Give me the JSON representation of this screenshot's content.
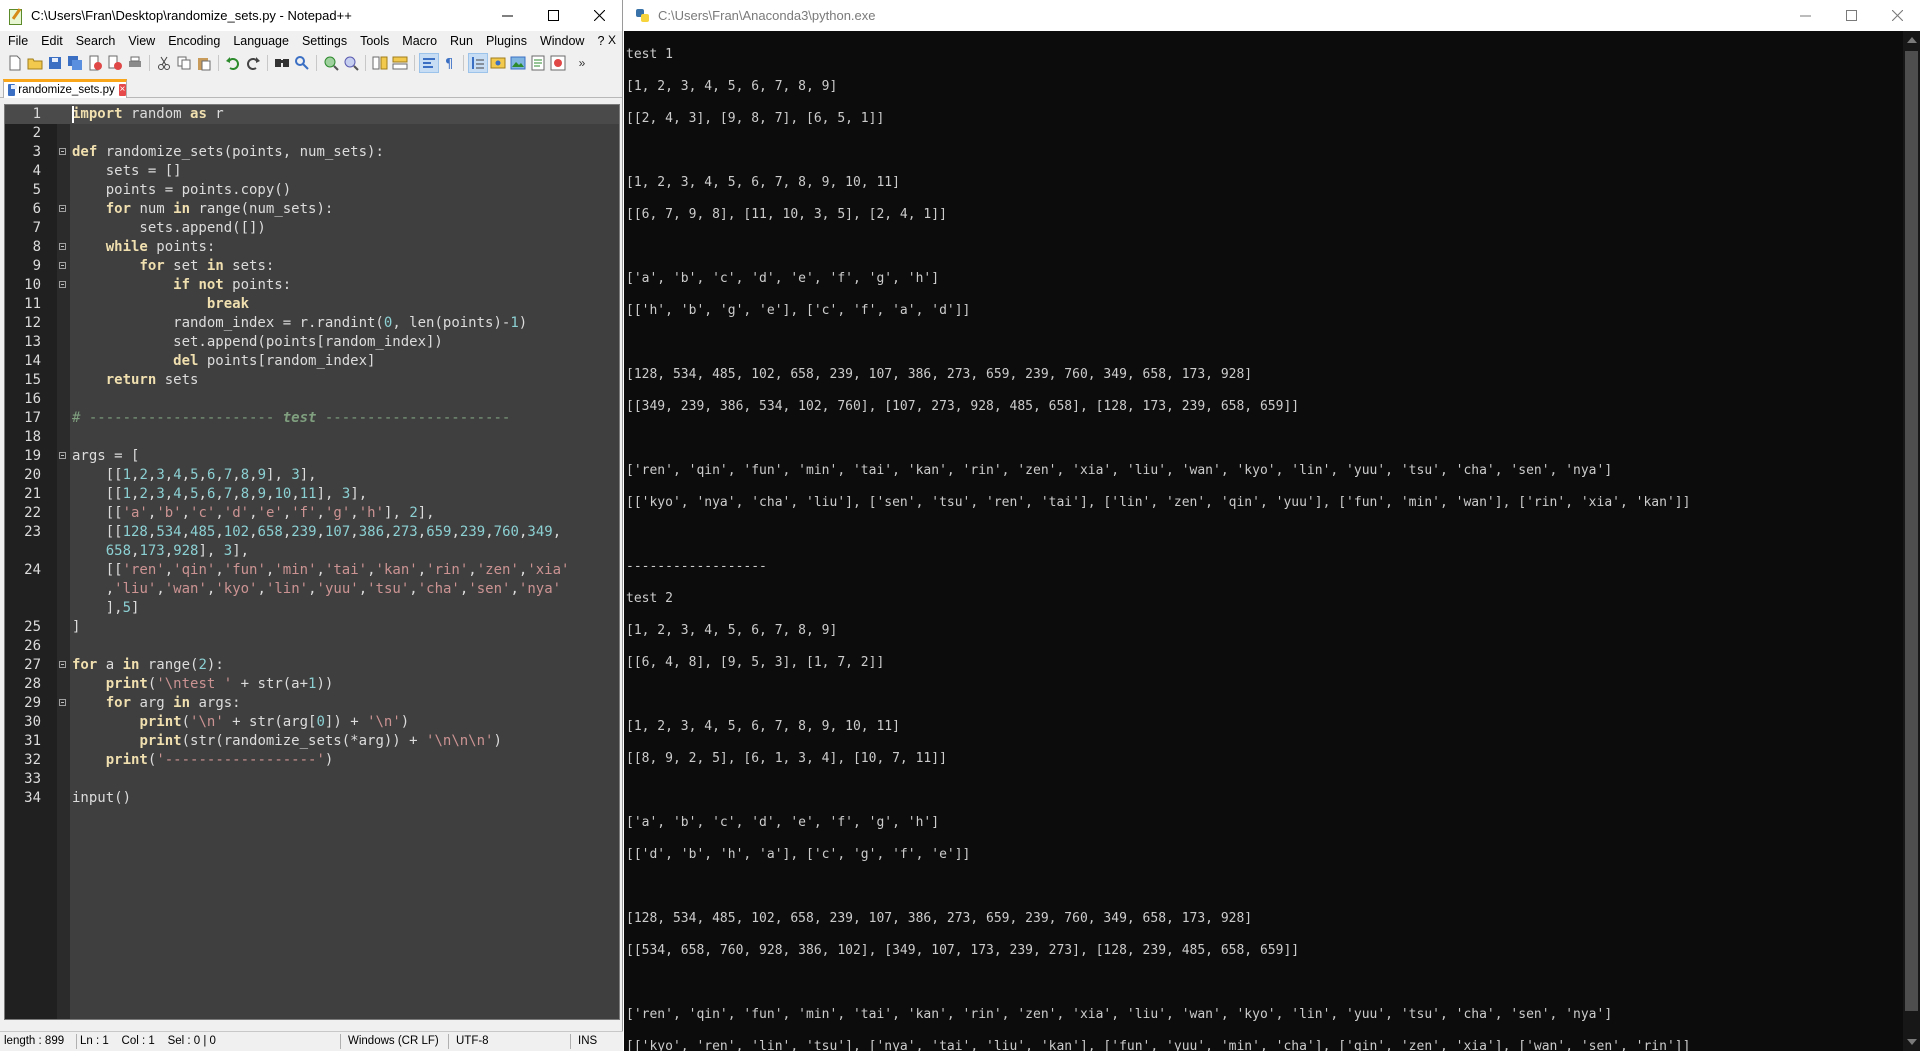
{
  "notepad": {
    "title": "C:\\Users\\Fran\\Desktop\\randomize_sets.py - Notepad++",
    "menu": [
      "File",
      "Edit",
      "Search",
      "View",
      "Encoding",
      "Language",
      "Settings",
      "Tools",
      "Macro",
      "Run",
      "Plugins",
      "Window",
      "?"
    ],
    "menu_close": "X",
    "tab_name": "randomize_sets.py",
    "tab_close": "×",
    "toolbar_icons": [
      "new-file-icon",
      "open-file-icon",
      "save-icon",
      "save-all-icon",
      "close-icon",
      "close-all-icon",
      "print-icon",
      "cut-icon",
      "copy-icon",
      "paste-icon",
      "undo-icon",
      "redo-icon",
      "find-icon",
      "replace-icon",
      "zoom-in-icon",
      "zoom-out-icon",
      "sync-vertical-icon",
      "sync-horizontal-icon",
      "word-wrap-icon",
      "show-all-chars-icon",
      "indent-guide-icon",
      "udl-icon",
      "document-map-icon",
      "function-list-icon",
      "record-macro-icon"
    ],
    "status": {
      "length": "length : 899",
      "position": "Ln : 1    Col : 1    Sel : 0 | 0",
      "eol": "Windows (CR LF)",
      "encoding": "UTF-8",
      "mode": "INS"
    },
    "code_lines": [
      {
        "n": "1",
        "html": "<span class=\"kw\">import</span> random <span class=\"kw\">as</span> r"
      },
      {
        "n": "2",
        "html": ""
      },
      {
        "n": "3",
        "html": "<span class=\"kw\">def</span> randomize_sets(points, num_sets):"
      },
      {
        "n": "4",
        "html": "    sets = []"
      },
      {
        "n": "5",
        "html": "    points = points.copy()"
      },
      {
        "n": "6",
        "html": "    <span class=\"kw\">for</span> num <span class=\"kw\">in</span> range(num_sets):"
      },
      {
        "n": "7",
        "html": "        sets.append([])"
      },
      {
        "n": "8",
        "html": "    <span class=\"kw\">while</span> points:"
      },
      {
        "n": "9",
        "html": "        <span class=\"kw\">for</span> set <span class=\"kw\">in</span> sets:"
      },
      {
        "n": "10",
        "html": "            <span class=\"kw\">if not</span> points:"
      },
      {
        "n": "11",
        "html": "                <span class=\"kw\">break</span>"
      },
      {
        "n": "12",
        "html": "            random_index = r.randint(<span class=\"num\">0</span>, len(points)-<span class=\"num\">1</span>)"
      },
      {
        "n": "13",
        "html": "            set.append(points[random_index])"
      },
      {
        "n": "14",
        "html": "            <span class=\"kw\">del</span> points[random_index]"
      },
      {
        "n": "15",
        "html": "    <span class=\"kw\">return</span> sets"
      },
      {
        "n": "16",
        "html": ""
      },
      {
        "n": "17",
        "html": "<span class=\"cmt\"># ---------------------- </span><span class=\"cmt-i\">test</span><span class=\"cmt\"> ----------------------</span>"
      },
      {
        "n": "18",
        "html": ""
      },
      {
        "n": "19",
        "html": "args = ["
      },
      {
        "n": "20",
        "html": "    [[<span class=\"num\">1</span>,<span class=\"num\">2</span>,<span class=\"num\">3</span>,<span class=\"num\">4</span>,<span class=\"num\">5</span>,<span class=\"num\">6</span>,<span class=\"num\">7</span>,<span class=\"num\">8</span>,<span class=\"num\">9</span>], <span class=\"num\">3</span>],"
      },
      {
        "n": "21",
        "html": "    [[<span class=\"num\">1</span>,<span class=\"num\">2</span>,<span class=\"num\">3</span>,<span class=\"num\">4</span>,<span class=\"num\">5</span>,<span class=\"num\">6</span>,<span class=\"num\">7</span>,<span class=\"num\">8</span>,<span class=\"num\">9</span>,<span class=\"num\">10</span>,<span class=\"num\">11</span>], <span class=\"num\">3</span>],"
      },
      {
        "n": "22",
        "html": "    [[<span class=\"str\">'a'</span>,<span class=\"str\">'b'</span>,<span class=\"str\">'c'</span>,<span class=\"str\">'d'</span>,<span class=\"str\">'e'</span>,<span class=\"str\">'f'</span>,<span class=\"str\">'g'</span>,<span class=\"str\">'h'</span>], <span class=\"num\">2</span>],"
      },
      {
        "n": "23",
        "html": "    [[<span class=\"num\">128</span>,<span class=\"num\">534</span>,<span class=\"num\">485</span>,<span class=\"num\">102</span>,<span class=\"num\">658</span>,<span class=\"num\">239</span>,<span class=\"num\">107</span>,<span class=\"num\">386</span>,<span class=\"num\">273</span>,<span class=\"num\">659</span>,<span class=\"num\">239</span>,<span class=\"num\">760</span>,<span class=\"num\">349</span>,"
      },
      {
        "n": "",
        "html": "    <span class=\"num\">658</span>,<span class=\"num\">173</span>,<span class=\"num\">928</span>], <span class=\"num\">3</span>],"
      },
      {
        "n": "24",
        "html": "    [[<span class=\"str\">'ren'</span>,<span class=\"str\">'qin'</span>,<span class=\"str\">'fun'</span>,<span class=\"str\">'min'</span>,<span class=\"str\">'tai'</span>,<span class=\"str\">'kan'</span>,<span class=\"str\">'rin'</span>,<span class=\"str\">'zen'</span>,<span class=\"str\">'xia'</span>"
      },
      {
        "n": "",
        "html": "    ,<span class=\"str\">'liu'</span>,<span class=\"str\">'wan'</span>,<span class=\"str\">'kyo'</span>,<span class=\"str\">'lin'</span>,<span class=\"str\">'yuu'</span>,<span class=\"str\">'tsu'</span>,<span class=\"str\">'cha'</span>,<span class=\"str\">'sen'</span>,<span class=\"str\">'nya'</span>"
      },
      {
        "n": "",
        "html": "    ],<span class=\"num\">5</span>]"
      },
      {
        "n": "25",
        "html": "]"
      },
      {
        "n": "26",
        "html": ""
      },
      {
        "n": "27",
        "html": "<span class=\"kw\">for</span> a <span class=\"kw\">in</span> range(<span class=\"num\">2</span>):"
      },
      {
        "n": "28",
        "html": "    <span class=\"kw\">print</span>(<span class=\"str\">'\\ntest '</span> + str(a+<span class=\"num\">1</span>))"
      },
      {
        "n": "29",
        "html": "    <span class=\"kw\">for</span> arg <span class=\"kw\">in</span> args:"
      },
      {
        "n": "30",
        "html": "        <span class=\"kw\">print</span>(<span class=\"str\">'\\n'</span> + str(arg[<span class=\"num\">0</span>]) + <span class=\"str\">'\\n'</span>)"
      },
      {
        "n": "31",
        "html": "        <span class=\"kw\">print</span>(str(randomize_sets(*arg)) + <span class=\"str\">'\\n\\n\\n'</span>)"
      },
      {
        "n": "32",
        "html": "    <span class=\"kw\">print</span>(<span class=\"str\">'------------------'</span>)"
      },
      {
        "n": "33",
        "html": ""
      },
      {
        "n": "34",
        "html": "input()"
      }
    ]
  },
  "console": {
    "title": "C:\\Users\\Fran\\Anaconda3\\python.exe",
    "lines": [
      "test 1",
      "[1, 2, 3, 4, 5, 6, 7, 8, 9]",
      "[[2, 4, 3], [9, 8, 7], [6, 5, 1]]",
      "",
      "[1, 2, 3, 4, 5, 6, 7, 8, 9, 10, 11]",
      "[[6, 7, 9, 8], [11, 10, 3, 5], [2, 4, 1]]",
      "",
      "['a', 'b', 'c', 'd', 'e', 'f', 'g', 'h']",
      "[['h', 'b', 'g', 'e'], ['c', 'f', 'a', 'd']]",
      "",
      "[128, 534, 485, 102, 658, 239, 107, 386, 273, 659, 239, 760, 349, 658, 173, 928]",
      "[[349, 239, 386, 534, 102, 760], [107, 273, 928, 485, 658], [128, 173, 239, 658, 659]]",
      "",
      "['ren', 'qin', 'fun', 'min', 'tai', 'kan', 'rin', 'zen', 'xia', 'liu', 'wan', 'kyo', 'lin', 'yuu', 'tsu', 'cha', 'sen', 'nya']",
      "[['kyo', 'nya', 'cha', 'liu'], ['sen', 'tsu', 'ren', 'tai'], ['lin', 'zen', 'qin', 'yuu'], ['fun', 'min', 'wan'], ['rin', 'xia', 'kan']]",
      "",
      "------------------",
      "test 2",
      "[1, 2, 3, 4, 5, 6, 7, 8, 9]",
      "[[6, 4, 8], [9, 5, 3], [1, 7, 2]]",
      "",
      "[1, 2, 3, 4, 5, 6, 7, 8, 9, 10, 11]",
      "[[8, 9, 2, 5], [6, 1, 3, 4], [10, 7, 11]]",
      "",
      "['a', 'b', 'c', 'd', 'e', 'f', 'g', 'h']",
      "[['d', 'b', 'h', 'a'], ['c', 'g', 'f', 'e']]",
      "",
      "[128, 534, 485, 102, 658, 239, 107, 386, 273, 659, 239, 760, 349, 658, 173, 928]",
      "[[534, 658, 760, 928, 386, 102], [349, 107, 173, 239, 273], [128, 239, 485, 658, 659]]",
      "",
      "['ren', 'qin', 'fun', 'min', 'tai', 'kan', 'rin', 'zen', 'xia', 'liu', 'wan', 'kyo', 'lin', 'yuu', 'tsu', 'cha', 'sen', 'nya']",
      "[['kyo', 'ren', 'lin', 'tsu'], ['nya', 'tai', 'liu', 'kan'], ['fun', 'yuu', 'min', 'cha'], ['qin', 'zen', 'xia'], ['wan', 'sen', 'rin']]"
    ]
  }
}
